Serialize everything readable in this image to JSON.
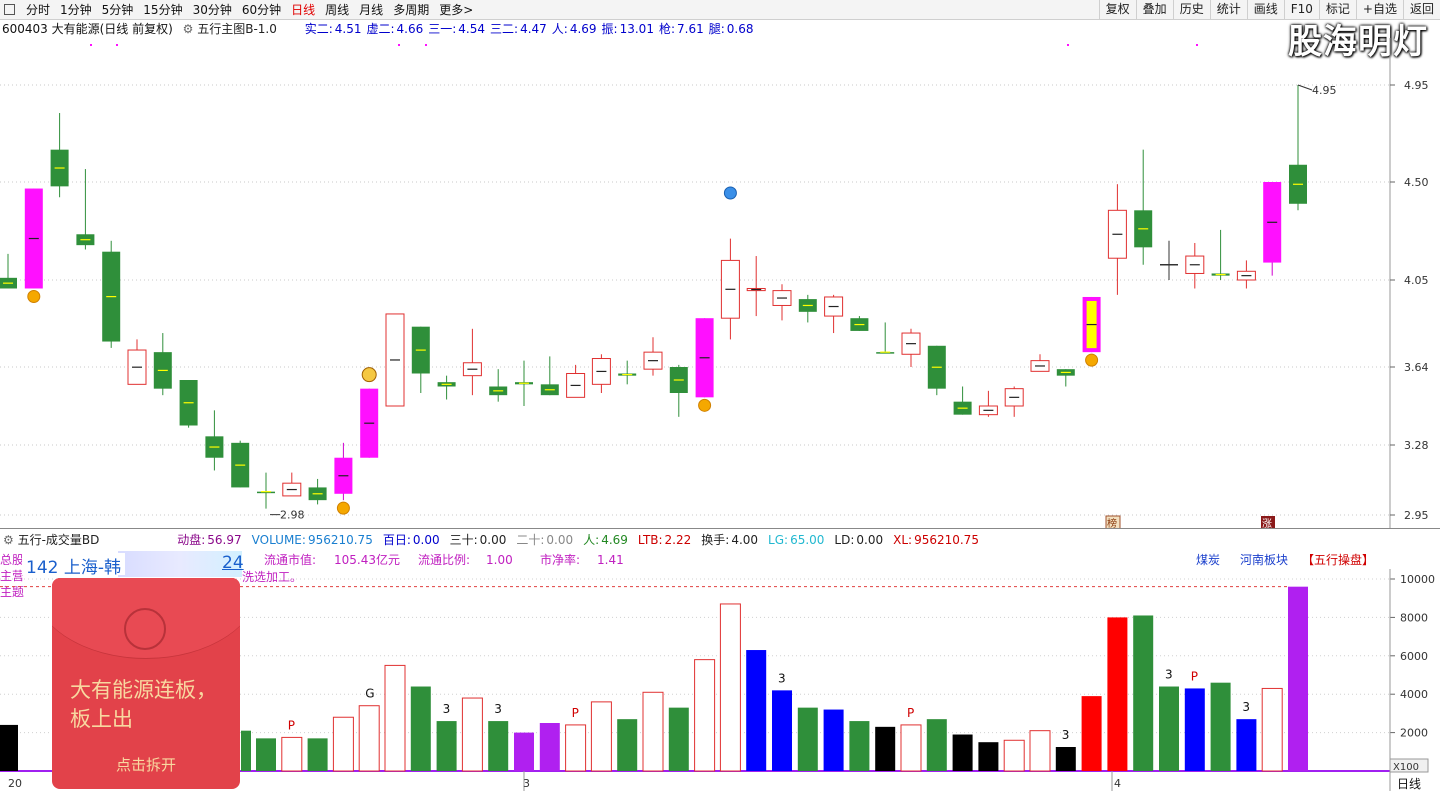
{
  "toolbar": {
    "items": [
      "分时",
      "1分钟",
      "5分钟",
      "15分钟",
      "30分钟",
      "60分钟",
      "日线",
      "周线",
      "月线",
      "多周期",
      "更多>"
    ],
    "active_index": 6,
    "right_items": [
      "复权",
      "叠加",
      "历史",
      "统计",
      "画线",
      "F10",
      "标记",
      "+自选",
      "返回"
    ]
  },
  "watermark": "股海明灯",
  "stock": {
    "code_name": "600403 大有能源(日线 前复权)",
    "template": "五行主图B-1.0",
    "indicators": [
      {
        "label": "实二:",
        "value": "4.51"
      },
      {
        "label": "虚二:",
        "value": "4.66"
      },
      {
        "label": "三一:",
        "value": "4.54"
      },
      {
        "label": "三二:",
        "value": "4.47"
      },
      {
        "label": "人:",
        "value": "4.69"
      },
      {
        "label": "振:",
        "value": "13.01"
      },
      {
        "label": "枪:",
        "value": "7.61"
      },
      {
        "label": "腿:",
        "value": "0.68"
      }
    ]
  },
  "price_axis": {
    "ticks": [
      "4.95",
      "4.50",
      "4.05",
      "3.64",
      "3.28",
      "2.95"
    ],
    "high_label": "4.95",
    "low_label": "2.98"
  },
  "markers": {
    "bang": "榜",
    "zhang": "涨"
  },
  "volume_panel": {
    "title": "五行-成交量BD",
    "fields": [
      {
        "label": "动盘:",
        "value": "56.97",
        "color": "#8b0a8b"
      },
      {
        "label": "VOLUME:",
        "value": "956210.75",
        "color": "#1a7fd0"
      },
      {
        "label": "百日:",
        "value": "0.00",
        "color": "#0000cc"
      },
      {
        "label": "三十:",
        "value": "0.00",
        "color": "#222222"
      },
      {
        "label": "二十:",
        "value": "0.00",
        "color": "#888888"
      },
      {
        "label": "人:",
        "value": "4.69",
        "color": "#228822"
      },
      {
        "label": "LTB:",
        "value": "2.22",
        "color": "#cc0000"
      },
      {
        "label": "换手:",
        "value": "4.00",
        "color": "#222222"
      },
      {
        "label": "LG:",
        "value": "65.00",
        "color": "#22b8d0"
      },
      {
        "label": "LD:",
        "value": "0.00",
        "color": "#222222"
      },
      {
        "label": "XL:",
        "value": "956210.75",
        "color": "#cc0000"
      }
    ],
    "row2": {
      "float_cap_label": "流通市值:",
      "float_cap": "105.43亿元",
      "float_ratio_label": "流通比例:",
      "float_ratio": "1.00",
      "pb_label": "市净率:",
      "pb": "1.41",
      "tags": [
        "煤炭",
        "河南板块",
        "【五行操盘】"
      ],
      "left_fragments": [
        "总股",
        "主营",
        "主题"
      ],
      "line3_fragment": "洗选加工。"
    },
    "axis_ticks": [
      "10000",
      "8000",
      "6000",
      "4000",
      "2000"
    ],
    "unit": "X100"
  },
  "dates": {
    "label_a": "20",
    "label_b": "3",
    "label_c": "4"
  },
  "period_label": "日线",
  "popup": {
    "message": "大有能源连板，板上出",
    "open_label": "点击拆开"
  },
  "ticker": {
    "text": "142 上海-韩",
    "suffix": "24"
  },
  "candles": [
    {
      "o": 4.06,
      "c": 4.01,
      "h": 4.17,
      "l": 4.01,
      "col": "g"
    },
    {
      "o": 4.01,
      "c": 4.47,
      "h": 4.47,
      "l": 4.01,
      "col": "m"
    },
    {
      "o": 4.65,
      "c": 4.48,
      "h": 4.82,
      "l": 4.43,
      "col": "g"
    },
    {
      "o": 4.26,
      "c": 4.21,
      "h": 4.56,
      "l": 4.19,
      "col": "g"
    },
    {
      "o": 4.18,
      "c": 3.76,
      "h": 4.23,
      "l": 3.73,
      "col": "g"
    },
    {
      "o": 3.56,
      "c": 3.72,
      "h": 3.77,
      "l": 3.56,
      "col": "r"
    },
    {
      "o": 3.71,
      "c": 3.54,
      "h": 3.8,
      "l": 3.51,
      "col": "g"
    },
    {
      "o": 3.58,
      "c": 3.37,
      "h": 3.58,
      "l": 3.36,
      "col": "g"
    },
    {
      "o": 3.32,
      "c": 3.22,
      "h": 3.44,
      "l": 3.16,
      "col": "g"
    },
    {
      "o": 3.29,
      "c": 3.08,
      "h": 3.3,
      "l": 3.08,
      "col": "g"
    },
    {
      "o": 3.06,
      "c": 3.06,
      "h": 3.15,
      "l": 2.98,
      "col": "g"
    },
    {
      "o": 3.04,
      "c": 3.1,
      "h": 3.15,
      "l": 3.04,
      "col": "r"
    },
    {
      "o": 3.08,
      "c": 3.02,
      "h": 3.12,
      "l": 3.0,
      "col": "g"
    },
    {
      "o": 3.05,
      "c": 3.22,
      "h": 3.29,
      "l": 3.02,
      "col": "m"
    },
    {
      "o": 3.22,
      "c": 3.54,
      "h": 3.54,
      "l": 3.22,
      "col": "m"
    },
    {
      "o": 3.46,
      "c": 3.89,
      "h": 3.89,
      "l": 3.46,
      "col": "r"
    },
    {
      "o": 3.83,
      "c": 3.61,
      "h": 3.83,
      "l": 3.52,
      "col": "g"
    },
    {
      "o": 3.57,
      "c": 3.55,
      "h": 3.6,
      "l": 3.49,
      "col": "g"
    },
    {
      "o": 3.6,
      "c": 3.66,
      "h": 3.82,
      "l": 3.51,
      "col": "r"
    },
    {
      "o": 3.55,
      "c": 3.51,
      "h": 3.63,
      "l": 3.48,
      "col": "g"
    },
    {
      "o": 3.57,
      "c": 3.56,
      "h": 3.67,
      "l": 3.46,
      "col": "g"
    },
    {
      "o": 3.56,
      "c": 3.51,
      "h": 3.69,
      "l": 3.51,
      "col": "g"
    },
    {
      "o": 3.5,
      "c": 3.61,
      "h": 3.65,
      "l": 3.5,
      "col": "r"
    },
    {
      "o": 3.56,
      "c": 3.68,
      "h": 3.7,
      "l": 3.52,
      "col": "r"
    },
    {
      "o": 3.61,
      "c": 3.6,
      "h": 3.67,
      "l": 3.56,
      "col": "g"
    },
    {
      "o": 3.63,
      "c": 3.71,
      "h": 3.78,
      "l": 3.6,
      "col": "r"
    },
    {
      "o": 3.64,
      "c": 3.52,
      "h": 3.65,
      "l": 3.41,
      "col": "g"
    },
    {
      "o": 3.5,
      "c": 3.87,
      "h": 3.87,
      "l": 3.5,
      "col": "m"
    },
    {
      "o": 3.87,
      "c": 4.14,
      "h": 4.24,
      "l": 3.77,
      "col": "r"
    },
    {
      "o": 4.0,
      "c": 4.01,
      "h": 4.16,
      "l": 3.88,
      "col": "r"
    },
    {
      "o": 3.93,
      "c": 4.0,
      "h": 4.03,
      "l": 3.86,
      "col": "r"
    },
    {
      "o": 3.96,
      "c": 3.9,
      "h": 3.98,
      "l": 3.85,
      "col": "g"
    },
    {
      "o": 3.88,
      "c": 3.97,
      "h": 3.98,
      "l": 3.8,
      "col": "r"
    },
    {
      "o": 3.87,
      "c": 3.81,
      "h": 3.88,
      "l": 3.81,
      "col": "g"
    },
    {
      "o": 3.71,
      "c": 3.71,
      "h": 3.85,
      "l": 3.71,
      "col": "g"
    },
    {
      "o": 3.7,
      "c": 3.8,
      "h": 3.82,
      "l": 3.64,
      "col": "r"
    },
    {
      "o": 3.74,
      "c": 3.54,
      "h": 3.74,
      "l": 3.51,
      "col": "g"
    },
    {
      "o": 3.48,
      "c": 3.42,
      "h": 3.55,
      "l": 3.42,
      "col": "g"
    },
    {
      "o": 3.42,
      "c": 3.46,
      "h": 3.53,
      "l": 3.41,
      "col": "r"
    },
    {
      "o": 3.46,
      "c": 3.54,
      "h": 3.55,
      "l": 3.41,
      "col": "r"
    },
    {
      "o": 3.62,
      "c": 3.67,
      "h": 3.7,
      "l": 3.62,
      "col": "r"
    },
    {
      "o": 3.63,
      "c": 3.6,
      "h": 3.63,
      "l": 3.55,
      "col": "g"
    },
    {
      "o": 3.71,
      "c": 3.97,
      "h": 3.97,
      "l": 3.71,
      "col": "m",
      "inner": "y"
    },
    {
      "o": 4.15,
      "c": 4.37,
      "h": 4.49,
      "l": 3.98,
      "col": "r"
    },
    {
      "o": 4.37,
      "c": 4.2,
      "h": 4.65,
      "l": 4.12,
      "col": "g"
    },
    {
      "o": 4.12,
      "c": 4.12,
      "h": 4.23,
      "l": 4.05,
      "col": "k"
    },
    {
      "o": 4.08,
      "c": 4.16,
      "h": 4.22,
      "l": 4.01,
      "col": "r"
    },
    {
      "o": 4.08,
      "c": 4.07,
      "h": 4.28,
      "l": 4.05,
      "col": "g"
    },
    {
      "o": 4.05,
      "c": 4.09,
      "h": 4.14,
      "l": 4.01,
      "col": "r"
    },
    {
      "o": 4.13,
      "c": 4.5,
      "h": 4.5,
      "l": 4.07,
      "col": "m"
    },
    {
      "o": 4.58,
      "c": 4.4,
      "h": 4.95,
      "l": 4.37,
      "col": "g"
    }
  ],
  "volumes": [
    {
      "v": 2400,
      "col": "k"
    },
    {
      "v": 1700,
      "col": "g"
    },
    {
      "v": 1750,
      "col": "ro"
    },
    {
      "v": 1700,
      "col": "g"
    },
    {
      "v": 2800,
      "col": "ro"
    },
    {
      "v": 3400,
      "col": "ro"
    },
    {
      "v": 5500,
      "col": "ro"
    },
    {
      "v": 4400,
      "col": "g"
    },
    {
      "v": 2600,
      "col": "g"
    },
    {
      "v": 3800,
      "col": "ro"
    },
    {
      "v": 2600,
      "col": "g"
    },
    {
      "v": 2000,
      "col": "p"
    },
    {
      "v": 2500,
      "col": "p"
    },
    {
      "v": 2400,
      "col": "ro"
    },
    {
      "v": 3600,
      "col": "ro"
    },
    {
      "v": 2700,
      "col": "g"
    },
    {
      "v": 4100,
      "col": "ro"
    },
    {
      "v": 3300,
      "col": "g"
    },
    {
      "v": 5800,
      "col": "ro"
    },
    {
      "v": 8700,
      "col": "ro"
    },
    {
      "v": 6300,
      "col": "b"
    },
    {
      "v": 4200,
      "col": "b"
    },
    {
      "v": 3300,
      "col": "g"
    },
    {
      "v": 3200,
      "col": "b"
    },
    {
      "v": 2600,
      "col": "g"
    },
    {
      "v": 2300,
      "col": "k"
    },
    {
      "v": 2400,
      "col": "ro"
    },
    {
      "v": 2700,
      "col": "g"
    },
    {
      "v": 1900,
      "col": "k"
    },
    {
      "v": 1500,
      "col": "k"
    },
    {
      "v": 1600,
      "col": "ro"
    },
    {
      "v": 2100,
      "col": "ro"
    },
    {
      "v": 1250,
      "col": "k"
    },
    {
      "v": 3900,
      "col": "r"
    },
    {
      "v": 8000,
      "col": "r"
    },
    {
      "v": 8100,
      "col": "g"
    },
    {
      "v": 4400,
      "col": "g"
    },
    {
      "v": 4300,
      "col": "b"
    },
    {
      "v": 4600,
      "col": "g"
    },
    {
      "v": 2700,
      "col": "b"
    },
    {
      "v": 4300,
      "col": "ro"
    },
    {
      "v": 9600,
      "col": "p"
    }
  ],
  "vol_labels": [
    {
      "i": 2,
      "t": "P",
      "col": "#d00000"
    },
    {
      "i": 5,
      "t": "G",
      "col": "#111111"
    },
    {
      "i": 8,
      "t": "3",
      "col": "#111111"
    },
    {
      "i": 10,
      "t": "3",
      "col": "#111111"
    },
    {
      "i": 13,
      "t": "P",
      "col": "#d00000"
    },
    {
      "i": 21,
      "t": "3",
      "col": "#111111"
    },
    {
      "i": 26,
      "t": "P",
      "col": "#d00000"
    },
    {
      "i": 32,
      "t": "3",
      "col": "#111111"
    },
    {
      "i": 36,
      "t": "3",
      "col": "#111111"
    },
    {
      "i": 37,
      "t": "P",
      "col": "#d00000"
    },
    {
      "i": 39,
      "t": "3",
      "col": "#111111"
    }
  ]
}
